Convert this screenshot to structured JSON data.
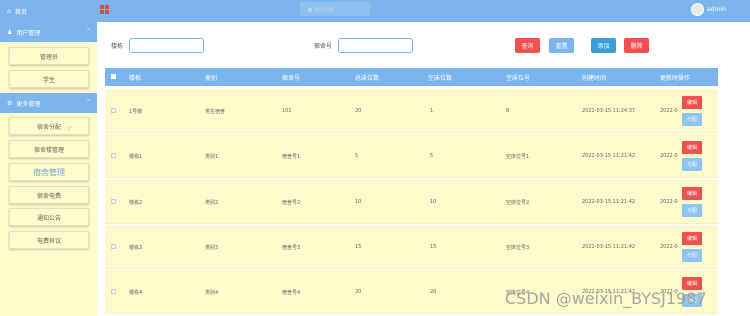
{
  "sidebar": {
    "home_label": "首页",
    "groups": [
      {
        "label": "用户管理",
        "items": [
          "管理员",
          "学生"
        ]
      },
      {
        "label": "更多管理",
        "items": [
          "宿舍分配",
          "宿舍楼管理",
          "宿舍管理",
          "宿舍电费",
          "通知公告",
          "电费异议"
        ]
      }
    ]
  },
  "topbar": {
    "search_text": "● 请点击此",
    "user": "admin"
  },
  "search": {
    "field1_label": "楼栋",
    "field2_label": "宿舍号",
    "query_btn": "查询",
    "reset_btn": "重置",
    "add_btn": "添加",
    "delete_btn": "删除"
  },
  "table": {
    "headers": [
      "楼栋",
      "类别",
      "宿舍号",
      "总床位数",
      "空床位数",
      "空床位号",
      "创建时间",
      "更新时",
      "操作"
    ],
    "rows": [
      [
        "1号楼",
        "男生宿舍",
        "101",
        "20",
        "1",
        "8",
        "2022-03-15 11:24:37",
        "2022-0"
      ],
      [
        "楼栋1",
        "类别1",
        "宿舍号1",
        "5",
        "5",
        "空床位号1",
        "2022-03-15 11:21:42",
        "2022-0"
      ],
      [
        "楼栋2",
        "类别2",
        "宿舍号2",
        "10",
        "10",
        "空床位号2",
        "2022-03-15 11:21:42",
        "2022-0"
      ],
      [
        "楼栋3",
        "类别3",
        "宿舍号3",
        "15",
        "15",
        "空床位号3",
        "2022-03-15 11:21:42",
        "2022-0"
      ],
      [
        "楼栋4",
        "类别4",
        "宿舍号4",
        "20",
        "20",
        "空床位号4",
        "2022-03-15 11:21:42",
        "2022-0"
      ]
    ],
    "edit_label": "编辑",
    "assign_label": "分配"
  },
  "watermark": "CSDN @weixin_BYSJ1987",
  "colors": {
    "primary": "#7cb5ec",
    "sidebar_bg": "#fdfacb",
    "danger": "#f0504f",
    "query": "#f0504f",
    "reset": "#7cb5ec",
    "add": "#3a9fd8"
  }
}
